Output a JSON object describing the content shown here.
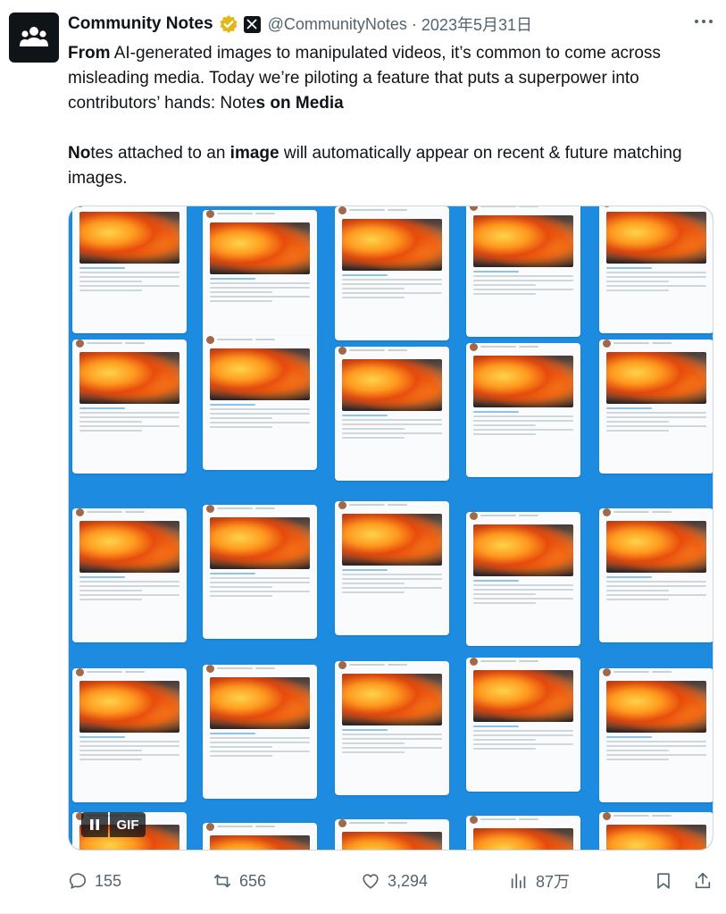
{
  "tweet": {
    "author_name": "Community Notes",
    "handle": "@CommunityNotes",
    "separator": "·",
    "date": "2023年5月31日",
    "paragraph1": {
      "bold_start": "From",
      "text": " AI-generated images to manipulated videos, it’s common to come across misleading media. Today we’re piloting a feature that puts a superpower into contributors’ hands: Note",
      "bold_end": "s on Media"
    },
    "paragraph2": {
      "bold_start": "No",
      "text_a": "tes attached to an ",
      "bold_mid": "image",
      "text_b": " will automatically appear on recent & future matching images."
    }
  },
  "media": {
    "type": "gif",
    "gif_label": "GIF",
    "background_color": "#1d8ce0"
  },
  "actions": {
    "reply_count": "155",
    "retweet_count": "656",
    "like_count": "3,294",
    "view_count": "87万"
  },
  "colors": {
    "text": "#0f1419",
    "secondary": "#536471",
    "verified_gold": "#e2b719"
  }
}
